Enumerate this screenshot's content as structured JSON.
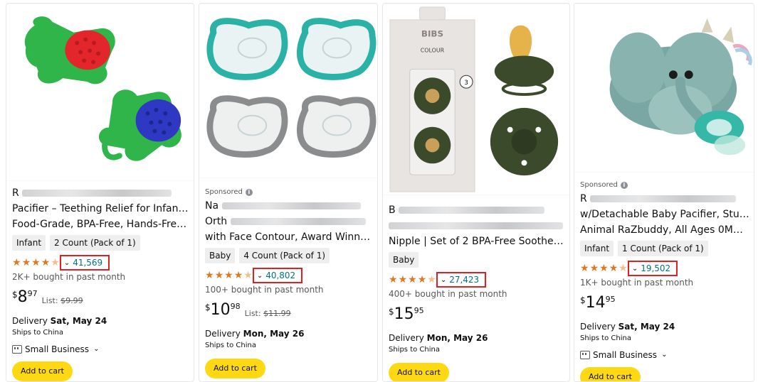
{
  "products": [
    {
      "sponsored": "",
      "title_lines": [
        "R",
        "Pacifier – Teething Relief for Infants,",
        "Food-Grade, BPA-Free, Hands-Free,..."
      ],
      "chips": [
        "Infant",
        "2 Count (Pack of 1)"
      ],
      "rating_stars": 4.5,
      "reviews": "41,569",
      "bought": "2K+ bought in past month",
      "price": {
        "currency": "$",
        "whole": "8",
        "fraction": "97"
      },
      "list_label": "List:",
      "list_price": "$9.99",
      "delivery_label": "Delivery",
      "delivery_date": "Sat, May 24",
      "ships": "Ships to China",
      "small_business": "Small Business",
      "add_to_cart": "Add to cart"
    },
    {
      "sponsored": "Sponsored",
      "title_lines": [
        "Na",
        "Orth",
        "with Face Contour, Award Winning..."
      ],
      "chips": [
        "Baby",
        "4 Count (Pack of 1)"
      ],
      "rating_stars": 4.5,
      "reviews": "40,802",
      "bought": "100+ bought in past month",
      "price": {
        "currency": "$",
        "whole": "10",
        "fraction": "98"
      },
      "list_label": "List:",
      "list_price": "$11.99",
      "delivery_label": "Delivery",
      "delivery_date": "Mon, May 26",
      "ships": "Ships to China",
      "add_to_cart": "Add to cart"
    },
    {
      "sponsored": "",
      "title_lines": [
        "B",
        "",
        "Nipple | Set of 2 BPA-Free Soother..."
      ],
      "chips": [
        "Baby"
      ],
      "rating_stars": 4.5,
      "reviews": "27,423",
      "bought": "400+ bought in past month",
      "price": {
        "currency": "$",
        "whole": "15",
        "fraction": "95"
      },
      "delivery_label": "Delivery",
      "delivery_date": "Mon, May 26",
      "ships": "Ships to China",
      "add_to_cart": "Add to cart",
      "package_brand": "BIBS",
      "package_name": "COLOUR"
    },
    {
      "sponsored": "Sponsored",
      "title_lines": [
        "R",
        "w/Detachable Baby Pacifier, Stuffed",
        "Animal RaZbuddy, All Ages 0M+,..."
      ],
      "chips": [
        "Infant",
        "1 Count (Pack of 1)"
      ],
      "rating_stars": 4.5,
      "reviews": "19,502",
      "bought": "1K+ bought in past month",
      "price": {
        "currency": "$",
        "whole": "14",
        "fraction": "95"
      },
      "delivery_label": "Delivery",
      "delivery_date": "Sat, May 24",
      "ships": "Ships to China",
      "small_business": "Small Business",
      "add_to_cart": "Add to cart"
    }
  ],
  "colors": {
    "star": "#de7921",
    "link": "#007185",
    "button": "#ffd814",
    "highlight": "#e02020"
  },
  "icons": {
    "star": "star-icon",
    "chevron": "chevron-down-icon",
    "info": "info-icon",
    "small_business": "store-icon"
  }
}
